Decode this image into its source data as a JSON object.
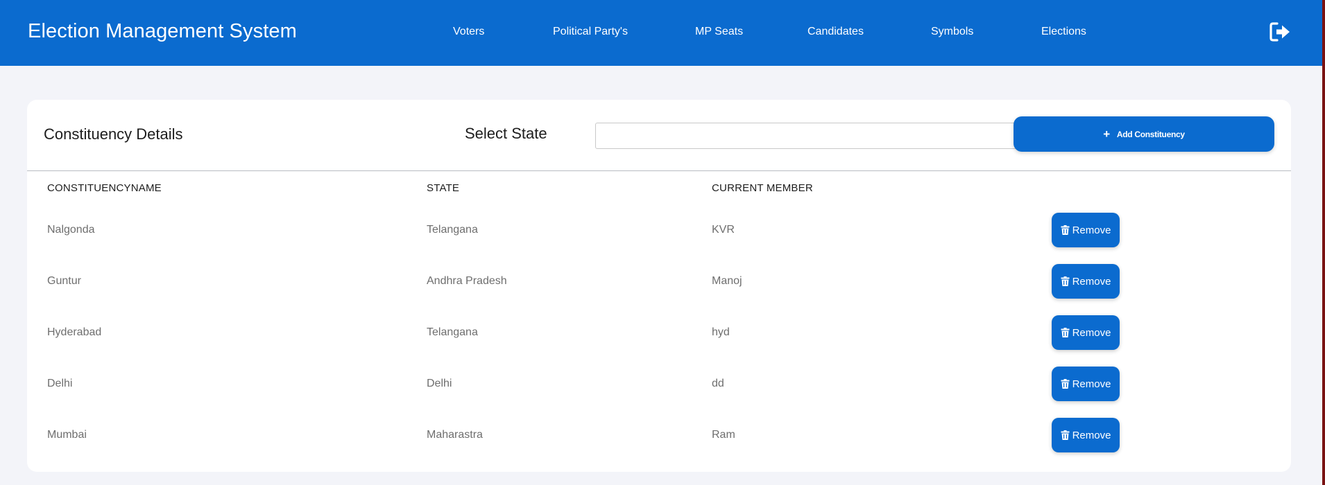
{
  "brand": "Election Management System",
  "nav": [
    {
      "label": "Voters"
    },
    {
      "label": "Political Party's"
    },
    {
      "label": "MP Seats"
    },
    {
      "label": "Candidates"
    },
    {
      "label": "Symbols"
    },
    {
      "label": "Elections"
    }
  ],
  "header": {
    "logout_icon": "logout-icon"
  },
  "card": {
    "title": "Constituency Details",
    "select_state_label": "Select State",
    "state_input_value": "",
    "add_button_label": "Add Constituency",
    "add_button_icon": "plus-icon"
  },
  "table": {
    "headers": [
      "CONSTITUENCYNAME",
      "STATE",
      "CURRENT MEMBER"
    ],
    "remove_label": "Remove",
    "remove_icon": "trash-icon",
    "rows": [
      {
        "name": "Nalgonda",
        "state": "Telangana",
        "member": "KVR"
      },
      {
        "name": "Guntur",
        "state": "Andhra Pradesh",
        "member": "Manoj"
      },
      {
        "name": "Hyderabad",
        "state": "Telangana",
        "member": "hyd"
      },
      {
        "name": "Delhi",
        "state": "Delhi",
        "member": "dd"
      },
      {
        "name": "Mumbai",
        "state": "Maharastra",
        "member": "Ram"
      }
    ]
  },
  "colors": {
    "accent": "#0b6bcf",
    "background": "#f3f4f9",
    "card": "#ffffff"
  }
}
